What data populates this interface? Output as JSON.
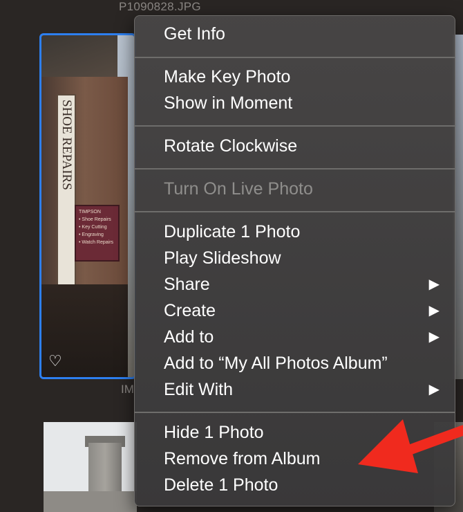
{
  "background": {
    "filename": "P1090828.JPG",
    "under_label": "IM"
  },
  "photo_sign": {
    "main": "SHOE REPAIRS",
    "small": "TIMPSON\n• Shoe Repairs\n• Key Cutting\n• Engraving\n• Watch Repairs"
  },
  "context_menu": {
    "get_info": "Get Info",
    "make_key_photo": "Make Key Photo",
    "show_in_moment": "Show in Moment",
    "rotate_clockwise": "Rotate Clockwise",
    "turn_on_live_photo": "Turn On Live Photo",
    "duplicate": "Duplicate 1 Photo",
    "play_slideshow": "Play Slideshow",
    "share": "Share",
    "create": "Create",
    "add_to": "Add to",
    "add_to_album": "Add to “My All Photos Album”",
    "edit_with": "Edit With",
    "hide": "Hide 1 Photo",
    "remove_from_album": "Remove from Album",
    "delete": "Delete 1 Photo",
    "submenu_arrow": "▶"
  },
  "icons": {
    "favorite": "heart-outline-icon",
    "annotation": "red-arrow-annotation"
  },
  "colors": {
    "selection": "#2d7ff0",
    "annotation_red": "#f02a1e",
    "disabled_text": "#8f8e8c"
  }
}
